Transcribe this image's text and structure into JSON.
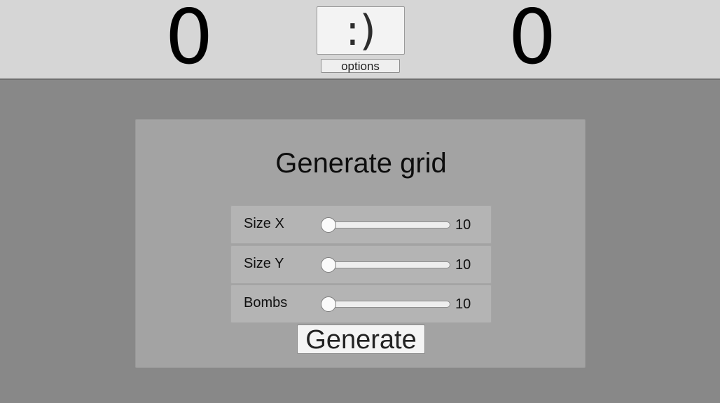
{
  "header": {
    "left_counter": "0",
    "smiley_label": ":)",
    "options_label": "options",
    "right_counter": "0"
  },
  "generate_panel": {
    "title": "Generate grid",
    "sliders": [
      {
        "label": "Size X",
        "value": "10",
        "level": 0
      },
      {
        "label": "Size Y",
        "value": "10",
        "level": 0
      },
      {
        "label": "Bombs",
        "value": "10",
        "level": 0
      }
    ],
    "generate_label": "Generate"
  },
  "colors": {
    "header_bg": "#d6d6d6",
    "page_bg": "#888888",
    "panel_bg": "#a3a3a3",
    "row_bg": "#b4b4b4"
  }
}
